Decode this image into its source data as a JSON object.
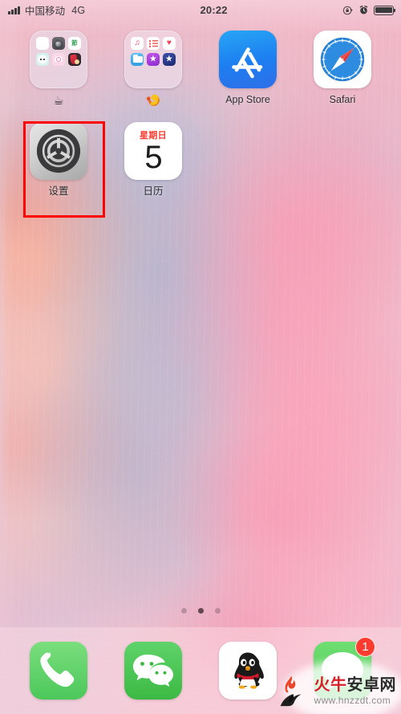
{
  "status_bar": {
    "signal_icon": "signal-bars-icon",
    "carrier": "中国移动",
    "network": "4G",
    "time": "20:22",
    "rotation_lock_icon": "rotation-lock-icon",
    "alarm_icon": "alarm-clock-icon",
    "battery_icon": "battery-full-icon"
  },
  "home_screen": {
    "row1": [
      {
        "type": "folder",
        "name": "folder-1",
        "label": "☕",
        "mini_icons": [
          "photos-icon",
          "camera-icon",
          "green-text-app-icon",
          "face-app-icon",
          "pink-camera-icon",
          "red-character-app-icon"
        ],
        "mini_text": "節"
      },
      {
        "type": "folder",
        "name": "folder-2",
        "label": "🍤",
        "mini_icons": [
          "music-icon",
          "reminders-icon",
          "health-icon",
          "files-icon",
          "itunes-store-icon",
          "app-store-star-icon"
        ]
      },
      {
        "type": "app",
        "name": "app-store",
        "label": "App Store",
        "icon": "app-store-icon"
      },
      {
        "type": "app",
        "name": "safari",
        "label": "Safari",
        "icon": "safari-compass-icon"
      }
    ],
    "row2": [
      {
        "type": "app",
        "name": "settings",
        "label": "设置",
        "icon": "settings-gear-icon",
        "highlighted": true
      },
      {
        "type": "app",
        "name": "calendar",
        "label": "日历",
        "icon": "calendar-icon",
        "weekday": "星期日",
        "day": "5"
      }
    ]
  },
  "page_dots": {
    "count": 3,
    "active_index": 1
  },
  "dock": [
    {
      "name": "phone",
      "icon": "phone-handset-icon",
      "badge": ""
    },
    {
      "name": "wechat",
      "icon": "wechat-bubbles-icon",
      "badge": ""
    },
    {
      "name": "qq",
      "icon": "qq-penguin-icon",
      "badge": ""
    },
    {
      "name": "messages",
      "icon": "messages-bubble-icon",
      "badge": "1"
    }
  ],
  "watermark": {
    "logo_icon": "bull-logo-icon",
    "brand_red": "火牛",
    "brand_dark": "安卓网",
    "url": "www.hnzzdt.com"
  },
  "colors": {
    "highlight_box": "#ff0000",
    "badge_red": "#ff3b30",
    "calendar_red": "#fb3b30",
    "wechat_green": "#3cb944",
    "phone_green": "#4cc85a",
    "app_store_blue": "#1d7ef0",
    "watermark_red": "#d81e26"
  }
}
